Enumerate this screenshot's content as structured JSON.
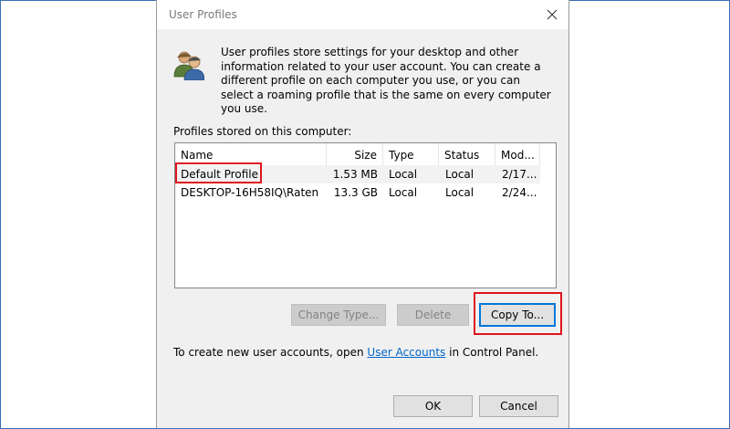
{
  "dialog": {
    "title": "User Profiles",
    "description": "User profiles store settings for your desktop and other information related to your user account. You can create a different profile on each computer you use, or you can select a roaming profile that is the same on every computer you use.",
    "list_label": "Profiles stored on this computer:",
    "columns": [
      "Name",
      "Size",
      "Type",
      "Status",
      "Mod..."
    ],
    "rows": [
      {
        "name": "Default Profile",
        "size": "1.53 MB",
        "type": "Local",
        "status": "Local",
        "modified": "2/17..."
      },
      {
        "name": "DESKTOP-16H58IQ\\Raten",
        "size": "13.3 GB",
        "type": "Local",
        "status": "Local",
        "modified": "2/24..."
      }
    ],
    "buttons": {
      "change_type": "Change Type...",
      "delete": "Delete",
      "copy_to": "Copy To...",
      "ok": "OK",
      "cancel": "Cancel"
    },
    "footer": {
      "prefix": "To create new user accounts, open ",
      "link": "User Accounts",
      "suffix": " in Control Panel."
    }
  },
  "colors": {
    "highlight_box": "#e0141e",
    "link": "#0066cc",
    "focus": "#0078d7"
  }
}
